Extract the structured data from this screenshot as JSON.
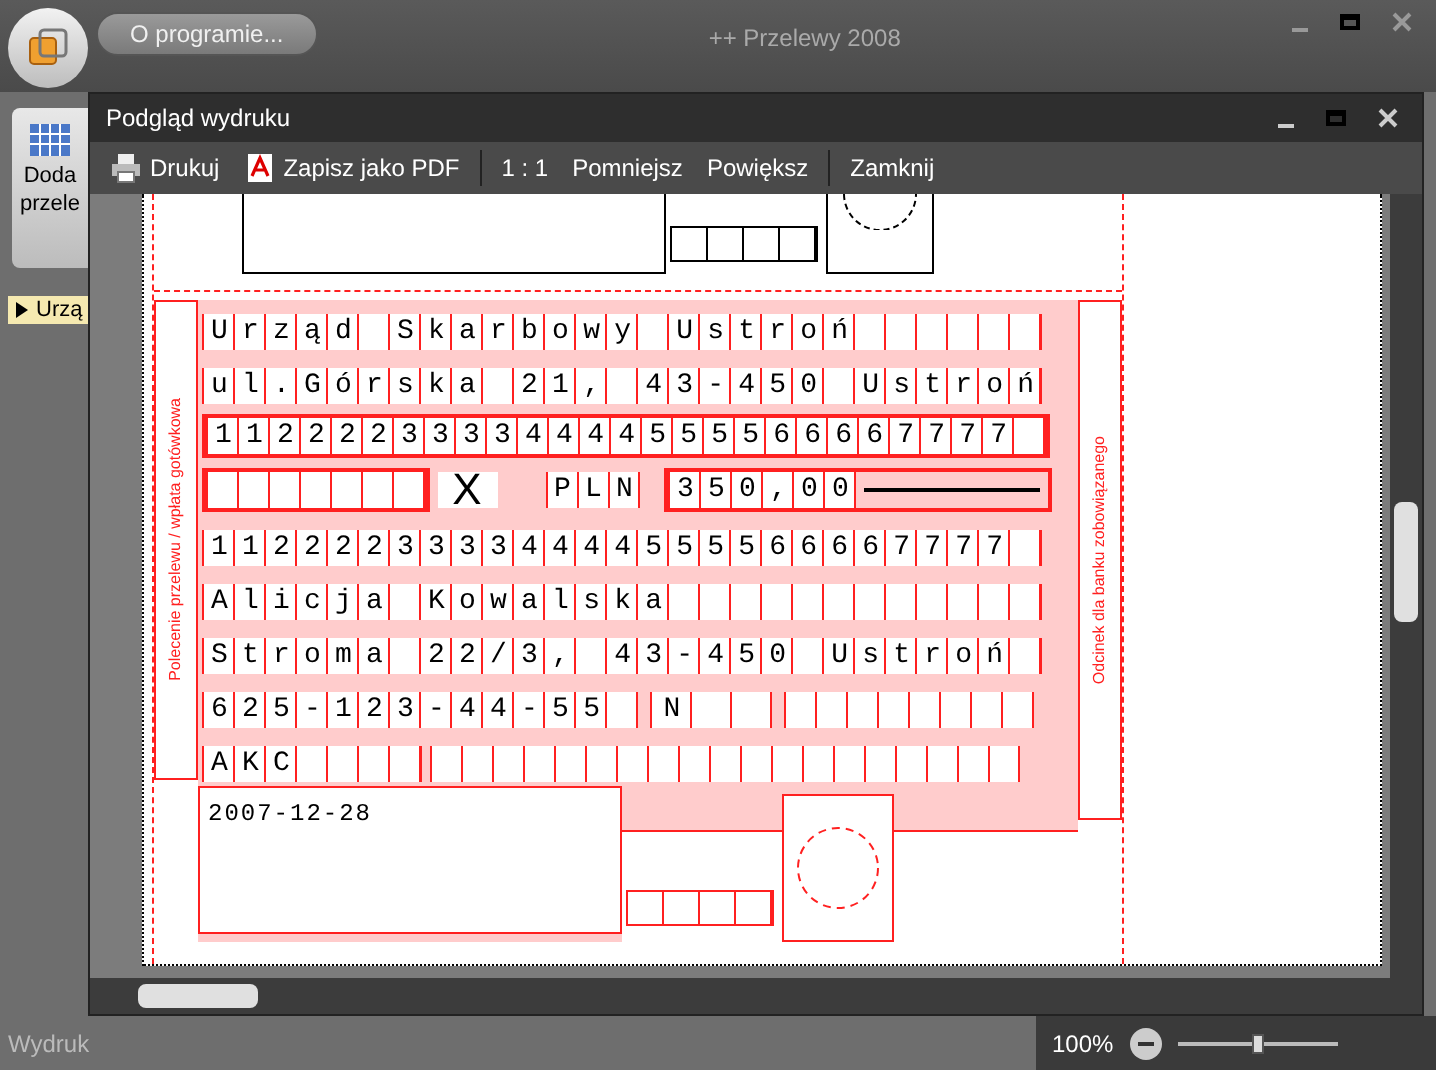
{
  "app": {
    "title": "++ Przelewy 2008",
    "about_button": "O programie...",
    "ribbon_button_lines": [
      "Doda",
      "przele"
    ],
    "sidebar_item": "Urzą",
    "status": "Wydruk",
    "zoom": "100%",
    "zoom_slider": {
      "level": 0.5
    }
  },
  "dialog": {
    "title": "Podgląd wydruku",
    "toolbar": [
      {
        "kind": "print",
        "label": "Drukuj"
      },
      {
        "kind": "pdf",
        "label": "Zapisz jako PDF"
      },
      {
        "kind": "separator"
      },
      {
        "kind": "button",
        "label": "1 : 1"
      },
      {
        "kind": "button",
        "label": "Pomniejsz"
      },
      {
        "kind": "button",
        "label": "Powiększ"
      },
      {
        "kind": "separator"
      },
      {
        "kind": "button",
        "label": "Zamknij"
      }
    ]
  },
  "form": {
    "side_left": "Polecenie przelewu / wpłata gotówkowa",
    "side_right": "Odcinek dla banku zobowiązanego",
    "rows": [
      {
        "kind": "text",
        "value": "Urząd Skarbowy Ustroń"
      },
      {
        "kind": "text",
        "value": "ul.Górska 21, 43-450 Ustroń"
      },
      {
        "kind": "account",
        "value": "11222233334444555566667777"
      },
      {
        "kind": "amount",
        "mark": "X",
        "currency": "PLN",
        "amount": "350,00"
      },
      {
        "kind": "text",
        "value": "11222233334444555566667777"
      },
      {
        "kind": "text",
        "value": "Alicja Kowalska"
      },
      {
        "kind": "text",
        "value": "Stroma 22/3, 43-450 Ustroń"
      },
      {
        "kind": "ids",
        "value": "625-123-44-55",
        "id_type": "N"
      },
      {
        "kind": "split",
        "value": "AKC"
      }
    ],
    "date": "2007-12-28"
  }
}
